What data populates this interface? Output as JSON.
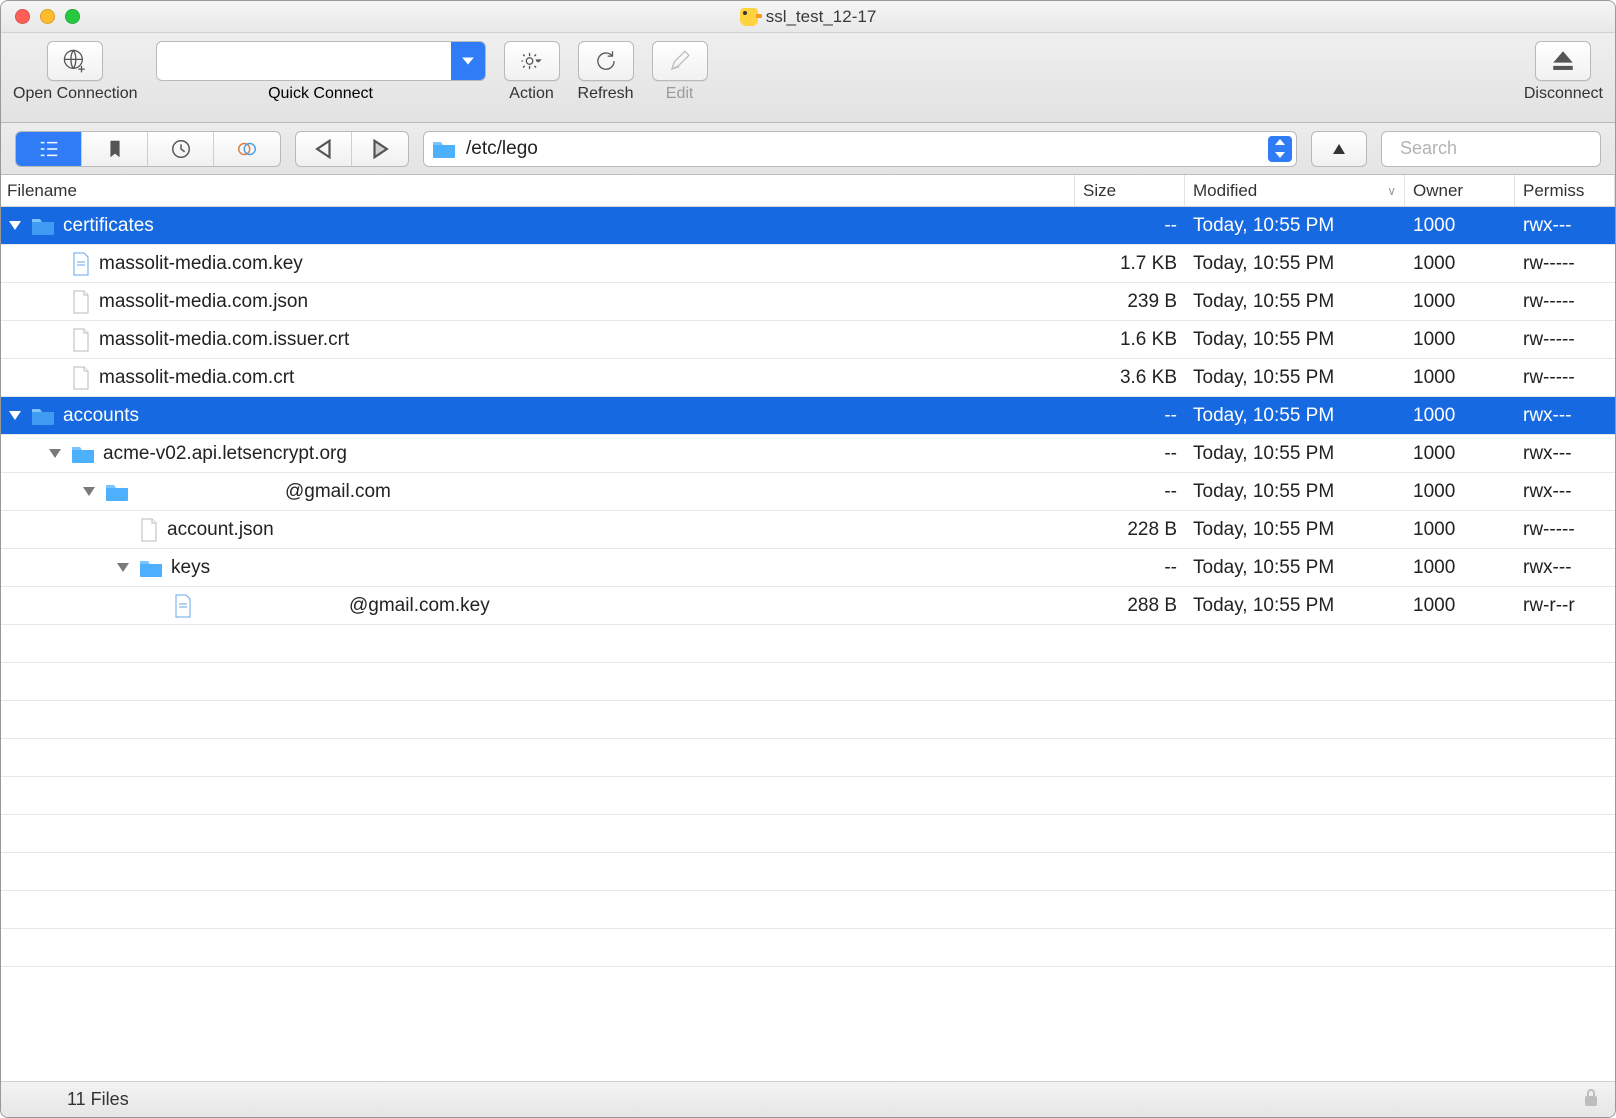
{
  "window": {
    "title": "ssl_test_12-17"
  },
  "toolbar": {
    "open_connection": "Open Connection",
    "quick_connect": "Quick Connect",
    "action": "Action",
    "refresh": "Refresh",
    "edit": "Edit",
    "disconnect": "Disconnect",
    "quick_connect_value": ""
  },
  "nav": {
    "path": "/etc/lego",
    "search_placeholder": "Search"
  },
  "columns": {
    "filename": "Filename",
    "size": "Size",
    "modified": "Modified",
    "owner": "Owner",
    "permissions": "Permiss"
  },
  "rows": [
    {
      "name": "certificates",
      "size": "--",
      "modified": "Today, 10:55 PM",
      "owner": "1000",
      "perm": "rwx---",
      "type": "folder",
      "indent": 0,
      "selected": true,
      "expanded": true
    },
    {
      "name": "massolit-media.com.key",
      "size": "1.7 KB",
      "modified": "Today, 10:55 PM",
      "owner": "1000",
      "perm": "rw-----",
      "type": "key",
      "indent": 1
    },
    {
      "name": "massolit-media.com.json",
      "size": "239 B",
      "modified": "Today, 10:55 PM",
      "owner": "1000",
      "perm": "rw-----",
      "type": "file",
      "indent": 1
    },
    {
      "name": "massolit-media.com.issuer.crt",
      "size": "1.6 KB",
      "modified": "Today, 10:55 PM",
      "owner": "1000",
      "perm": "rw-----",
      "type": "file",
      "indent": 1
    },
    {
      "name": "massolit-media.com.crt",
      "size": "3.6 KB",
      "modified": "Today, 10:55 PM",
      "owner": "1000",
      "perm": "rw-----",
      "type": "file",
      "indent": 1
    },
    {
      "name": "accounts",
      "size": "--",
      "modified": "Today, 10:55 PM",
      "owner": "1000",
      "perm": "rwx---",
      "type": "folder",
      "indent": 0,
      "selected": true,
      "expanded": true
    },
    {
      "name": "acme-v02.api.letsencrypt.org",
      "size": "--",
      "modified": "Today, 10:55 PM",
      "owner": "1000",
      "perm": "rwx---",
      "type": "folder",
      "indent": 1,
      "expanded": true
    },
    {
      "name": "@gmail.com",
      "size": "--",
      "modified": "Today, 10:55 PM",
      "owner": "1000",
      "perm": "rwx---",
      "type": "folder",
      "indent": 2,
      "expanded": true,
      "prepad": 140
    },
    {
      "name": "account.json",
      "size": "228 B",
      "modified": "Today, 10:55 PM",
      "owner": "1000",
      "perm": "rw-----",
      "type": "file",
      "indent": 3
    },
    {
      "name": "keys",
      "size": "--",
      "modified": "Today, 10:55 PM",
      "owner": "1000",
      "perm": "rwx---",
      "type": "folder",
      "indent": 3,
      "expanded": true
    },
    {
      "name": "@gmail.com.key",
      "size": "288 B",
      "modified": "Today, 10:55 PM",
      "owner": "1000",
      "perm": "rw-r--r",
      "type": "key",
      "indent": 4,
      "prepad": 140
    }
  ],
  "empty_rows": 9,
  "status": {
    "text": "11 Files"
  }
}
